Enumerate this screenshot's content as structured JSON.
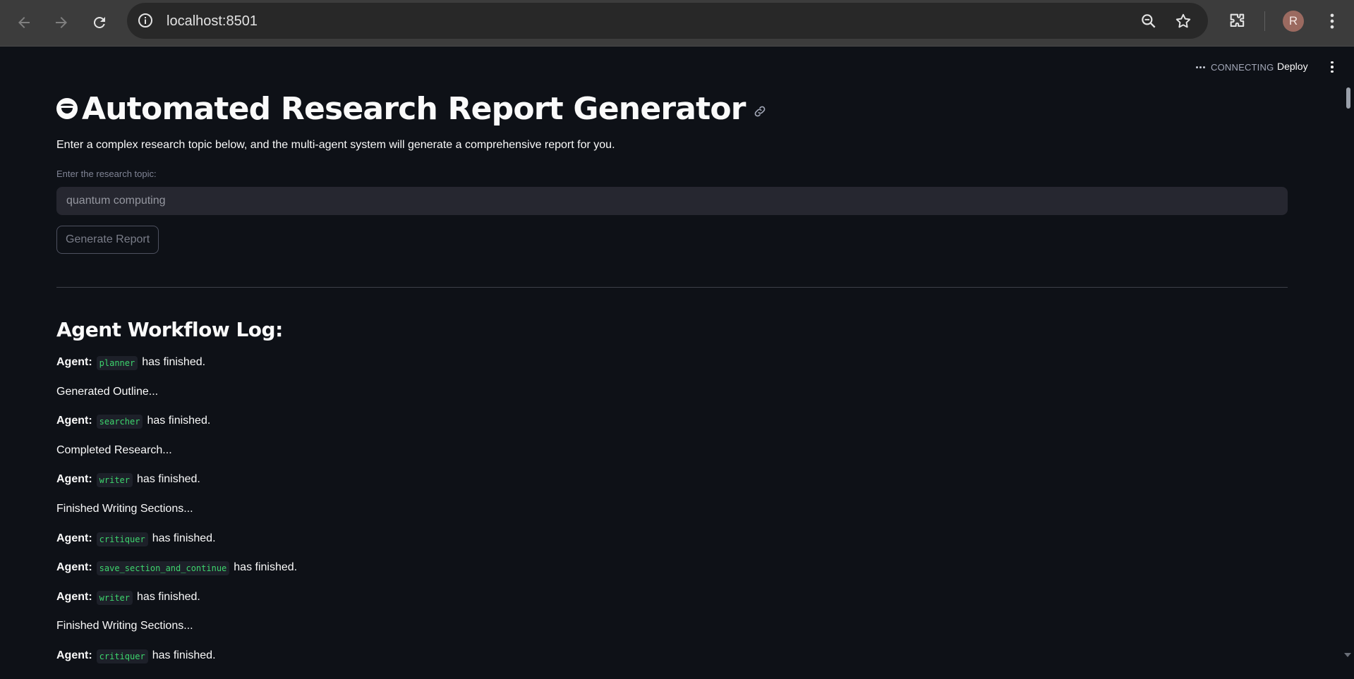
{
  "browser": {
    "url": "localhost:8501",
    "profile_initial": "R"
  },
  "app": {
    "status": "CONNECTING",
    "deploy_label": "Deploy",
    "title": "Automated Research Report Generator",
    "description": "Enter a complex research topic below, and the multi-agent system will generate a comprehensive report for you.",
    "input_label": "Enter the research topic:",
    "input_placeholder": "quantum computing",
    "button_label": "Generate Report",
    "log_heading": "Agent Workflow Log:",
    "log": [
      {
        "prefix": "Agent:",
        "agent": "planner",
        "suffix": "has finished."
      },
      {
        "text": "Generated Outline..."
      },
      {
        "prefix": "Agent:",
        "agent": "searcher",
        "suffix": "has finished."
      },
      {
        "text": "Completed Research..."
      },
      {
        "prefix": "Agent:",
        "agent": "writer",
        "suffix": "has finished."
      },
      {
        "text": "Finished Writing Sections..."
      },
      {
        "prefix": "Agent:",
        "agent": "critiquer",
        "suffix": "has finished."
      },
      {
        "prefix": "Agent:",
        "agent": "save_section_and_continue",
        "suffix": "has finished."
      },
      {
        "prefix": "Agent:",
        "agent": "writer",
        "suffix": "has finished."
      },
      {
        "text": "Finished Writing Sections..."
      },
      {
        "prefix": "Agent:",
        "agent": "critiquer",
        "suffix": "has finished."
      }
    ]
  }
}
